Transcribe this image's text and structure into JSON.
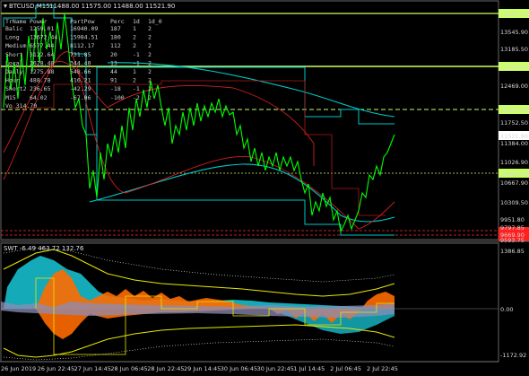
{
  "header": {
    "symbol": "BTCUSD,M15",
    "ohlc": "11488.00 11575.00 11488.00 11521.90"
  },
  "info_table": {
    "columns": [
      "TrName",
      "Power",
      "PartPow",
      "Perc",
      "1d",
      "1d_0"
    ],
    "rows": [
      [
        "Balic",
        "1259.01",
        "16940.09",
        "187",
        "1",
        "2"
      ],
      [
        "Long",
        "13672.44",
        "15984.51",
        "180",
        "2",
        "2"
      ],
      [
        "Medium",
        "6577.44",
        "8112.17",
        "112",
        "2",
        "2"
      ],
      [
        "Short",
        "3122.64",
        "731.85",
        "20",
        "-1",
        "2"
      ],
      [
        "Local",
        "2628.40",
        "344.40",
        "13",
        "-1",
        "2"
      ],
      [
        "Daily",
        "1275.88",
        "548.66",
        "44",
        "1",
        "2"
      ],
      [
        "Hour",
        "488.78",
        "416.21",
        "91",
        "2",
        "2"
      ],
      [
        "Short2",
        "236.65",
        "-42.29",
        "-18",
        "-1",
        "2"
      ],
      [
        "M15",
        "64.02",
        "-67.06",
        "-100",
        "-2",
        "2"
      ]
    ],
    "footer": "Vo 314.70"
  },
  "price_axis": {
    "labels": [
      "13857.20",
      "13545.90",
      "13185.50",
      "12829.87",
      "12469.00",
      "12047.49",
      "11752.50",
      "11521.90",
      "11384.00",
      "11026.90",
      "10829.00",
      "10667.90",
      "10309.50",
      "9951.80",
      "9797.85",
      "9669.90",
      "9593.75"
    ],
    "highlighted": {
      "top_level": "13857.20",
      "mid_level": "12829.87",
      "dashed_level": "12047.49",
      "current": "11521.90",
      "support": "10829.00",
      "red_a": "9797.85",
      "red_b": "9669.90"
    }
  },
  "oscillator": {
    "title": "SWT -6.49 463.72 132.76",
    "axis_labels": [
      "1386.85",
      "0.00",
      "-1172.92"
    ]
  },
  "time_axis": {
    "labels": [
      "26 Jun 2019",
      "26 Jun 22:45",
      "27 Jun 14:45",
      "28 Jun 06:45",
      "28 Jun 22:45",
      "29 Jun 14:45",
      "30 Jun 06:45",
      "30 Jun 22:45",
      "1 Jul 14:45",
      "2 Jul 06:45",
      "2 Jul 22:45"
    ]
  },
  "colors": {
    "background": "#000000",
    "candles": "#00ff00",
    "level_line": "#ccff66",
    "cyan_line": "#00c8c8",
    "red_line": "#d02020",
    "osc_cyan": "#18c8d8",
    "osc_orange": "#ff6a00",
    "osc_yellow": "#e8e800"
  }
}
